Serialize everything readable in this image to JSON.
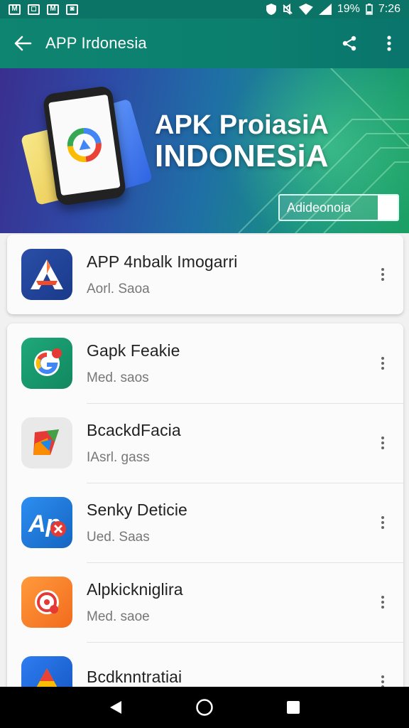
{
  "status_bar": {
    "icons_left": [
      "M",
      "◻",
      "M",
      "◙"
    ],
    "battery": "19%",
    "time": "7:26"
  },
  "app_bar": {
    "title": "APP Irdonesia",
    "back_icon": "arrow-left-icon",
    "share_icon": "share-icon",
    "menu_icon": "more-vert-icon"
  },
  "banner": {
    "title_line1": "APK ProiasiA",
    "title_line2": "INDONESiA",
    "button_label": "Adideonoia",
    "colors": {
      "start": "#3a2f8f",
      "end": "#1ba064"
    }
  },
  "apps": [
    {
      "name": "APP 4nbalk Imogarri",
      "sub": "Aorl. Saoa",
      "icon": "atlas-icon"
    },
    {
      "name": "Gapk Feakie",
      "sub": "Med. saos",
      "icon": "google-g-icon"
    },
    {
      "name": "BcackdFacia",
      "sub": "IAsrl. gass",
      "icon": "play-shape-icon"
    },
    {
      "name": "Senky Deticie",
      "sub": "Ued. Saas",
      "icon": "ap-icon"
    },
    {
      "name": "Alpkickniglira",
      "sub": "Med. saoe",
      "icon": "record-icon"
    },
    {
      "name": "Bcdknntratiai",
      "sub": "",
      "icon": "triangle-icon"
    }
  ]
}
